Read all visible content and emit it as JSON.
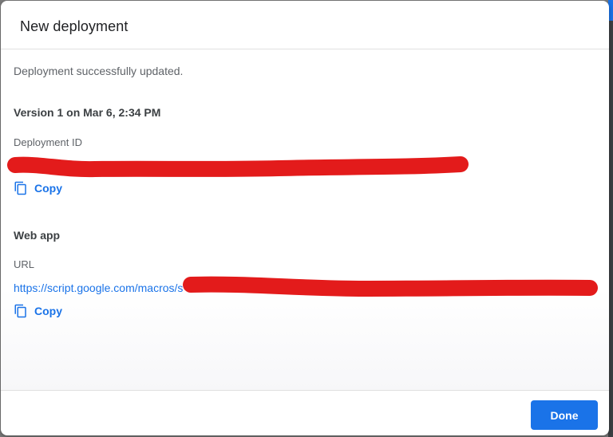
{
  "dialog": {
    "title": "New deployment",
    "success_message": "Deployment successfully updated.",
    "version": "Version 1 on Mar 6, 2:34 PM",
    "deployment_id": {
      "label": "Deployment ID",
      "copy_label": "Copy"
    },
    "web_app": {
      "heading": "Web app",
      "url_label": "URL",
      "url_prefix": "https://script.google.com/macros/s",
      "copy_label": "Copy"
    },
    "done_label": "Done"
  },
  "colors": {
    "accent": "#1a73e8",
    "redaction": "#e31b1b",
    "title_text": "#202124",
    "secondary_text": "#5f6368"
  },
  "icons": {
    "copy": "copy-icon"
  }
}
